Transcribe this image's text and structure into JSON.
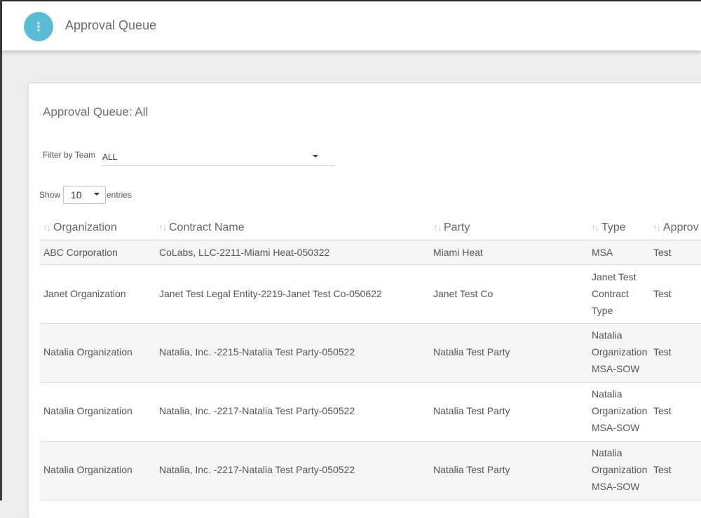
{
  "header": {
    "title": "Approval Queue",
    "menu_icon": "vertical-dots-icon",
    "menu_color": "#5bbcd6"
  },
  "card": {
    "title": "Approval Queue: All"
  },
  "filter": {
    "label": "Filter by Team",
    "value": "ALL"
  },
  "entries": {
    "show_label": "Show",
    "value": "10",
    "suffix_label": "entries"
  },
  "table": {
    "sort_icon": "↑↓",
    "columns": [
      "Organization",
      "Contract Name",
      "Party",
      "Type",
      "Approv"
    ],
    "rows": [
      {
        "organization": "ABC Corporation",
        "contract_name": "CoLabs, LLC-2211-Miami Heat-050322",
        "party": "Miami Heat",
        "type": "MSA",
        "approver": "Test"
      },
      {
        "organization": "Janet Organization",
        "contract_name": "Janet Test Legal Entity-2219-Janet Test Co-050622",
        "party": "Janet Test Co",
        "type": "Janet Test Contract Type",
        "approver": "Test"
      },
      {
        "organization": "Natalia Organization",
        "contract_name": "Natalia, Inc. -2215-Natalia Test Party-050522",
        "party": "Natalia Test Party",
        "type": "Natalia Organization MSA-SOW",
        "approver": "Test"
      },
      {
        "organization": "Natalia Organization",
        "contract_name": "Natalia, Inc. -2217-Natalia Test Party-050522",
        "party": "Natalia Test Party",
        "type": "Natalia Organization MSA-SOW",
        "approver": "Test"
      },
      {
        "organization": "Natalia Organization",
        "contract_name": "Natalia, Inc. -2217-Natalia Test Party-050522",
        "party": "Natalia Test Party",
        "type": "Natalia Organization MSA-SOW",
        "approver": "Test"
      }
    ]
  }
}
